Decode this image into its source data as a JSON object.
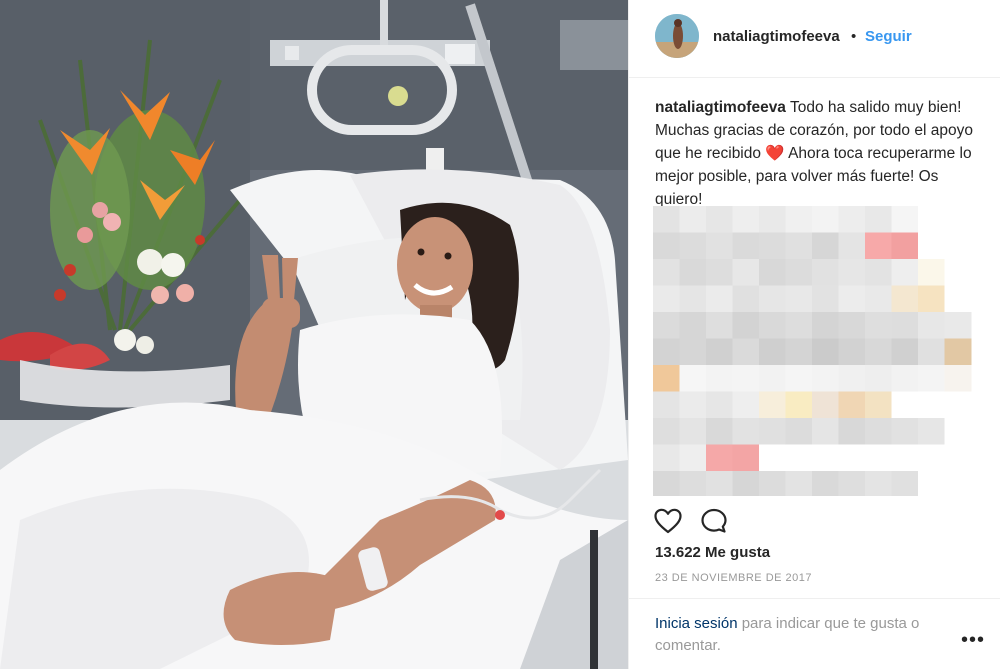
{
  "post": {
    "username": "nataliagtimofeeva",
    "separator": "•",
    "follow_label": "Seguir",
    "caption": {
      "username": "nataliagtimofeeva",
      "text_before_emoji": "Todo ha salido muy bien! Muchas gracias de corazón, por todo el apoyo que he recibido",
      "emoji": "❤️",
      "text_after_emoji": "Ahora toca recuperarme lo mejor posible, para volver más fuerte! Os quiero!"
    },
    "likes": "13.622 Me gusta",
    "date": "23 DE NOVIEMBRE DE 2017",
    "footer": {
      "login_link": "Inicia sesión",
      "login_rest": "para indicar que te gusta o comentar."
    },
    "more_label": "•••"
  },
  "icons": {
    "like": "heart-outline-icon",
    "comment": "speech-bubble-icon",
    "more": "ellipsis-icon"
  },
  "colors": {
    "follow": "#3897f0",
    "link": "#003569",
    "muted": "#999999",
    "text": "#262626",
    "border": "#efefef"
  },
  "blurred_comments": [
    [
      "#e3e3e3",
      "#ececec",
      "#e6e6e6",
      "#eeeeee",
      "#e9e9e9",
      "#f0f0f0",
      "#f3f3f3",
      "#ededed",
      "#e8e8e8",
      "#f5f5f5",
      "#ffffff",
      "#ffffff"
    ],
    [
      "#d9d9d9",
      "#dcdcdc",
      "#e1e1e1",
      "#dadada",
      "#dcdcdc",
      "#e0e0e0",
      "#d6d6d6",
      "#e4e4e4",
      "#f7a9a9",
      "#f2a0a0",
      "#ffffff",
      "#ffffff"
    ],
    [
      "#e2e2e2",
      "#d9d9d9",
      "#dddddd",
      "#e7e7e7",
      "#d8d8d8",
      "#dcdcdc",
      "#e1e1e1",
      "#e6e6e6",
      "#e3e3e3",
      "#eeeeee",
      "#fbf7ea",
      "#ffffff"
    ],
    [
      "#eaeaea",
      "#e5e5e5",
      "#ebebeb",
      "#e0e0e0",
      "#e6e6e6",
      "#e8e8e8",
      "#e2e2e2",
      "#ececec",
      "#e9e9e9",
      "#f4e7d0",
      "#f6e3c1",
      "#ffffff"
    ],
    [
      "#dbdbdb",
      "#d6d6d6",
      "#dedede",
      "#d3d3d3",
      "#d9d9d9",
      "#dddddd",
      "#d4d4d4",
      "#d8d8d8",
      "#dedede",
      "#dddddd",
      "#e7e7e7",
      "#e9e9e9"
    ],
    [
      "#d3d3d3",
      "#d6d6d6",
      "#d0d0d0",
      "#dadada",
      "#cfcfcf",
      "#d4d4d4",
      "#cbcbcb",
      "#d2d2d2",
      "#d8d8d8",
      "#d0d0d0",
      "#e0e0e0",
      "#e2c8a4"
    ],
    [
      "#f0c89a",
      "#f6f6f6",
      "#f3f3f3",
      "#f4f4f4",
      "#f2f2f2",
      "#f5f5f5",
      "#f3f3f3",
      "#f0f0f0",
      "#eeeeee",
      "#f2f2f2",
      "#f4f4f4",
      "#f7f3ee"
    ],
    [
      "#e4e4e4",
      "#ebebeb",
      "#e6e6e6",
      "#eeeeee",
      "#f7eedb",
      "#f9ecc2",
      "#efe3d6",
      "#f0d6b4",
      "#f3e2c2",
      "#ffffff",
      "#ffffff",
      "#ffffff"
    ],
    [
      "#dedede",
      "#e4e4e4",
      "#d9d9d9",
      "#e2e2e2",
      "#e0e0e0",
      "#dcdcdc",
      "#e5e5e5",
      "#d8d8d8",
      "#dddddd",
      "#e1e1e1",
      "#e6e6e6",
      "#ffffff"
    ],
    [
      "#e8e8e8",
      "#eeeeee",
      "#f5a8a8",
      "#f3a5a5",
      "#ffffff",
      "#ffffff",
      "#ffffff",
      "#ffffff",
      "#ffffff",
      "#ffffff",
      "#ffffff",
      "#ffffff"
    ],
    [
      "#d8d8d8",
      "#dddddd",
      "#e1e1e1",
      "#d6d6d6",
      "#dcdcdc",
      "#e3e3e3",
      "#d9d9d9",
      "#dedede",
      "#e4e4e4",
      "#e0e0e0",
      "#ffffff",
      "#ffffff"
    ]
  ]
}
